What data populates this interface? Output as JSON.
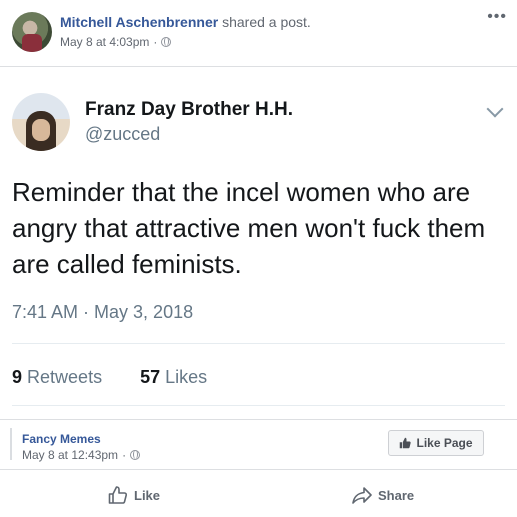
{
  "post": {
    "author": "Mitchell Aschenbrenner",
    "action": "shared a post.",
    "timestamp": "May 8 at 4:03pm",
    "separator": "·",
    "more_icon": "more-icon"
  },
  "tweet": {
    "display_name": "Franz Day Brother H.H.",
    "handle": "@zucced",
    "text": "Reminder that the incel women who are angry that attractive men won't fuck them are called feminists.",
    "time": "7:41 AM · May 3, 2018",
    "retweets_count": "9",
    "retweets_label": "Retweets",
    "likes_count": "57",
    "likes_label": "Likes"
  },
  "source_page": {
    "name": "Fancy Memes",
    "timestamp": "May 8 at 12:43pm",
    "separator": "·",
    "like_page_label": "Like Page"
  },
  "actions": {
    "like_label": "Like",
    "share_label": "Share"
  },
  "colors": {
    "link": "#365899",
    "secondary_text": "#616770",
    "tweet_gray": "#657786"
  }
}
